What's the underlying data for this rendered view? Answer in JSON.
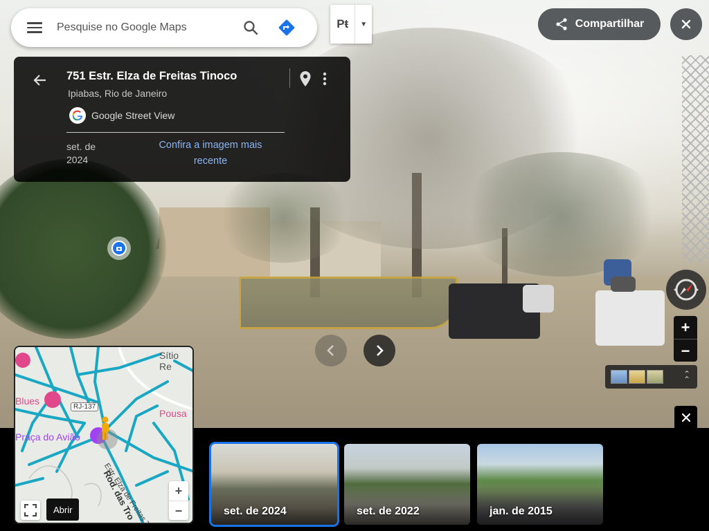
{
  "search": {
    "placeholder": "Pesquise no Google Maps"
  },
  "layer_toggle": {
    "label": "Pŧ"
  },
  "share": {
    "label": "Compartilhar"
  },
  "card": {
    "title": "751 Estr. Elza de Freitas Tinoco",
    "subtitle": "Ipiabas, Rio de Janeiro",
    "source": "Google Street View",
    "date_line1": "set. de",
    "date_line2": "2024",
    "link_line1": "Confira a imagem mais",
    "link_line2": "recente"
  },
  "minimap": {
    "labels": {
      "sitio": "Sítio Re",
      "blues": "Blues",
      "road_shield": "RJ-137",
      "pousada": "Pousa",
      "praca": "Praça do Avião",
      "estr": "Estr. Elza de Freitas T",
      "rod": "Rod. das Tro"
    },
    "tooltip": "Abrir",
    "zoom_in": "+",
    "zoom_out": "−"
  },
  "zoom": {
    "in": "+",
    "out": "−"
  },
  "timeline": [
    {
      "label": "set. de 2024",
      "selected": true
    },
    {
      "label": "set. de 2022",
      "selected": false
    },
    {
      "label": "jan. de 2015",
      "selected": false
    }
  ],
  "colors": {
    "accent": "#1a73e8",
    "link": "#8ab4f8",
    "road": "#19a7c4",
    "poi_pink": "#e0488b",
    "pegman": "#f2a900"
  }
}
